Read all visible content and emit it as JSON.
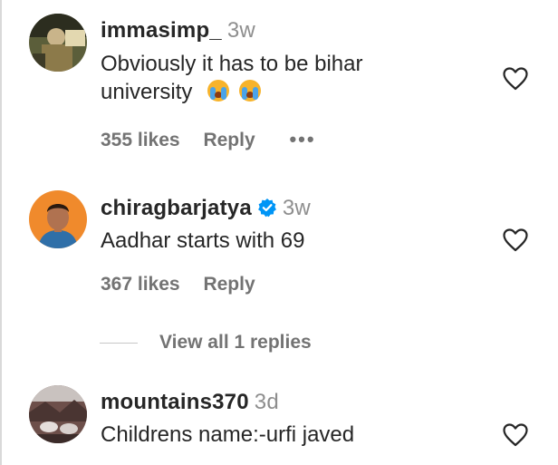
{
  "comments": [
    {
      "username": "immasimp_",
      "time": "3w",
      "verified": false,
      "text_line1": "Obviously it has to be bihar",
      "text_line2": "university",
      "emoji": "loudly-crying-face",
      "likes": "355 likes",
      "reply_label": "Reply",
      "more_label": "•••"
    },
    {
      "username": "chiragbarjatya",
      "time": "3w",
      "verified": true,
      "text": "Aadhar starts with 69",
      "likes": "367 likes",
      "reply_label": "Reply",
      "view_replies": "View all 1 replies"
    },
    {
      "username": "mountains370",
      "time": "3d",
      "verified": false,
      "text": "Childrens name:-urfi javed"
    }
  ],
  "icons": {
    "like": "heart-icon",
    "verified": "verified-badge-icon",
    "more": "more-options-icon"
  },
  "colors": {
    "text": "#262626",
    "secondary": "#737373",
    "timestamp": "#8e8e8e",
    "verified": "#0095f6"
  }
}
